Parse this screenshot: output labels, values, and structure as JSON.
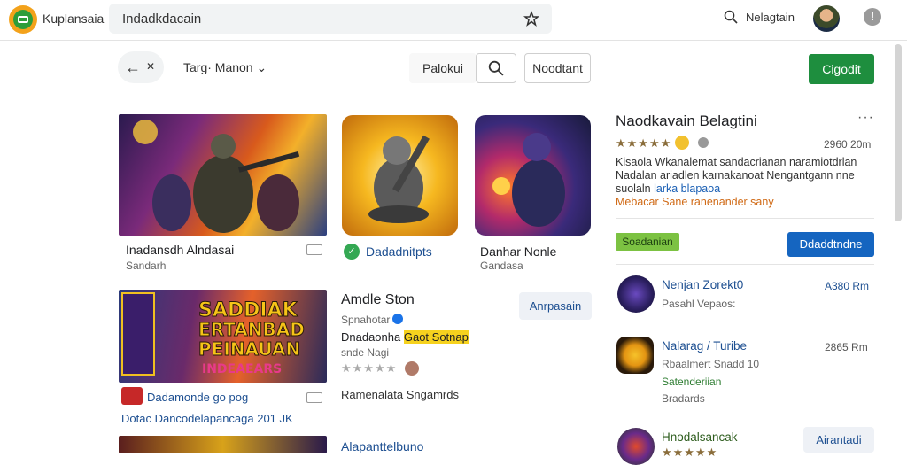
{
  "header": {
    "brand": "Kuplansaia",
    "search_value": "Indadkdacain",
    "user_name": "Nelagtain",
    "info_label": "!"
  },
  "toolbar": {
    "filter_label": "Targ· Manon ⌄",
    "plain_label": "Palokui",
    "outline_label": "Noodtant",
    "green_label": "Cigodit"
  },
  "cards": [
    {
      "title": "Inadansdh Alndasai",
      "sub": "Sandarh"
    },
    {
      "title": "Dadadnitpts",
      "sub": ""
    },
    {
      "title": "Danhar Nonle",
      "sub": "Gandasa"
    }
  ],
  "featured": {
    "title": "Amdle Ston",
    "line1": "Spnahotar",
    "line2_prefix": "Dnadaonha",
    "line2_highlight": "Gaot Sotnap",
    "line3": "snde Nagi",
    "button": "Anrpasain",
    "banner_text": [
      "SADDIAK",
      "ERTANBAD",
      "PEINAUAN",
      "INDEAEARS"
    ],
    "footer_link": "Dadamonde go pog",
    "footer_sub": "Dotac Dancodelapancaga 201 JK",
    "footer_right": "Ramenalata Sngamrds",
    "next_title": "Alapanttelbuno"
  },
  "detail": {
    "title": "Naodkavain Belagtini",
    "more": "···",
    "size": "2960 20m",
    "desc_line1": "Kisaola Wkanalemat sandacrianan naramiotdrlan",
    "desc_line2": "Nadalan ariadlen karnakanoat Nengantgann nne",
    "desc_line3_prefix": "suolaln",
    "desc_line3_link": "larka blapaoa",
    "desc_line4": "Mebacar Sane ranenander sany",
    "badge": "Soadanian",
    "button": "Ddaddtndne"
  },
  "related": [
    {
      "name": "Nenjan Zorekt0",
      "sub": "Pasahl Vepaos:",
      "size": "A380 Rm"
    },
    {
      "name": "Nalarag / Turibe",
      "sub": "Rbaalmert Snadd 10",
      "sub2": "Satenderiian",
      "sub3": "Bradards",
      "size": "2865 Rm"
    },
    {
      "name": "Hnodalsancak",
      "button": "Airantadi"
    }
  ],
  "colors": {
    "accent_green": "#1e8e3e",
    "accent_blue": "#1565c0",
    "link_blue": "#1d4f91",
    "badge_green": "#7cc242"
  }
}
